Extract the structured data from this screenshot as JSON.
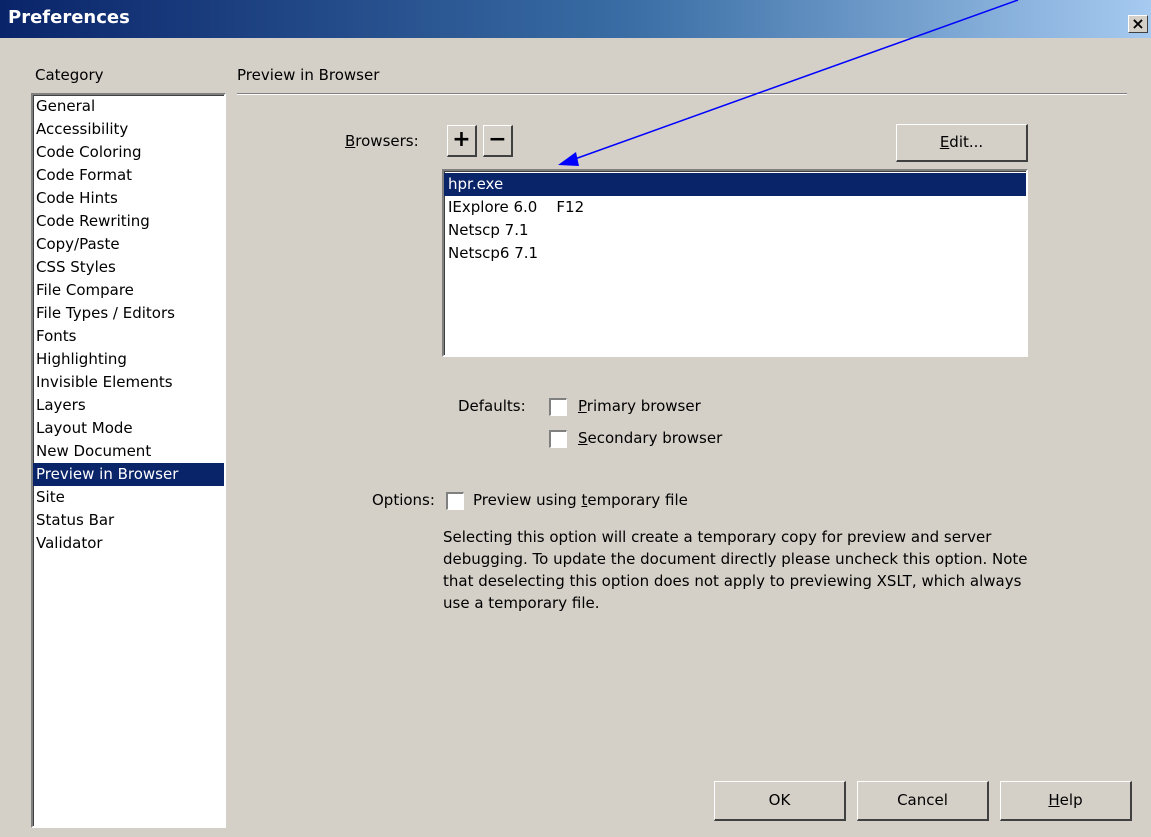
{
  "window": {
    "title": "Preferences",
    "close_glyph": "×",
    "title_gradient": [
      "#0a246a",
      "#a6caf0"
    ]
  },
  "category": {
    "label": "Category",
    "items": [
      "General",
      "Accessibility",
      "Code Coloring",
      "Code Format",
      "Code Hints",
      "Code Rewriting",
      "Copy/Paste",
      "CSS Styles",
      "File Compare",
      "File Types / Editors",
      "Fonts",
      "Highlighting",
      "Invisible Elements",
      "Layers",
      "Layout Mode",
      "New Document",
      "Preview in Browser",
      "Site",
      "Status Bar",
      "Validator"
    ],
    "selected": "Preview in Browser"
  },
  "panel": {
    "title": "Preview in Browser",
    "browsers": {
      "label_mnemonic": "B",
      "label_rest": "rowsers:",
      "add_glyph": "+",
      "remove_glyph": "−",
      "edit_mnemonic": "E",
      "edit_rest": "dit...",
      "items": [
        "hpr.exe",
        "IExplore 6.0    F12",
        "Netscp 7.1",
        "Netscp6 7.1"
      ],
      "selected": "hpr.exe"
    },
    "defaults": {
      "label": "Defaults:",
      "primary_mnemonic": "P",
      "primary_rest": "rimary browser",
      "primary_checked": false,
      "secondary_mnemonic": "S",
      "secondary_rest": "econdary browser",
      "secondary_checked": false
    },
    "options": {
      "label": "Options:",
      "temp_before": "Preview using ",
      "temp_mnemonic": "t",
      "temp_after": "emporary file",
      "temp_checked": false,
      "description": "Selecting this option will create a temporary copy for preview and server debugging. To update the document directly please uncheck this option. Note that deselecting this option does not apply to previewing XSLT, which always use a temporary file."
    }
  },
  "buttons": {
    "ok": "OK",
    "cancel": "Cancel",
    "help_mnemonic": "H",
    "help_rest": "elp"
  },
  "colors": {
    "selection": "#0a246a",
    "dialog_bg": "#d4d0c8",
    "annotation_arrow": "#0000ff"
  }
}
